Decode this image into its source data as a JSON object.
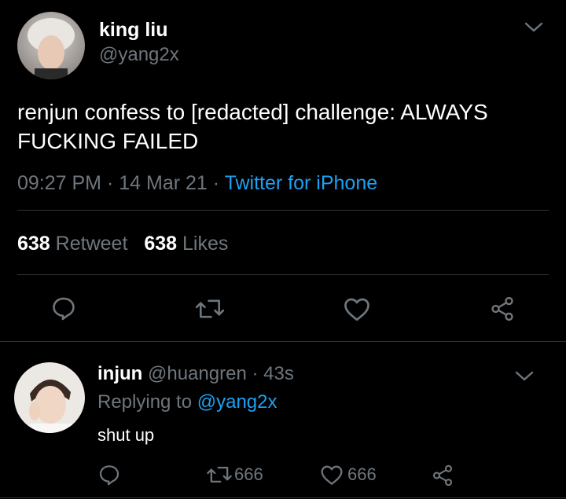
{
  "tweet": {
    "author_name": "king liu",
    "author_handle": "@yang2x",
    "text": "renjun confess to [redacted] challenge: ALWAYS FUCKING FAILED",
    "time": "09:27 PM",
    "sep1": "·",
    "date": "14 Mar 21",
    "sep2": "·",
    "source": "Twitter for iPhone",
    "retweet_count": "638",
    "retweet_label": "Retweet",
    "like_count": "638",
    "like_label": "Likes"
  },
  "reply": {
    "author_name": "injun",
    "author_handle": "@huangren",
    "sep": "·",
    "age": "43s",
    "replying_prefix": "Replying to",
    "replying_handle": "@yang2x",
    "text": "shut up",
    "retweet_count": "666",
    "like_count": "666"
  },
  "colors": {
    "background": "#000000",
    "text": "#ffffff",
    "muted": "#6e767d",
    "link": "#1da1f2",
    "divider": "#2f3336"
  },
  "icons": [
    "chevron-down-icon",
    "reply-icon",
    "retweet-icon",
    "heart-icon",
    "share-icon"
  ]
}
